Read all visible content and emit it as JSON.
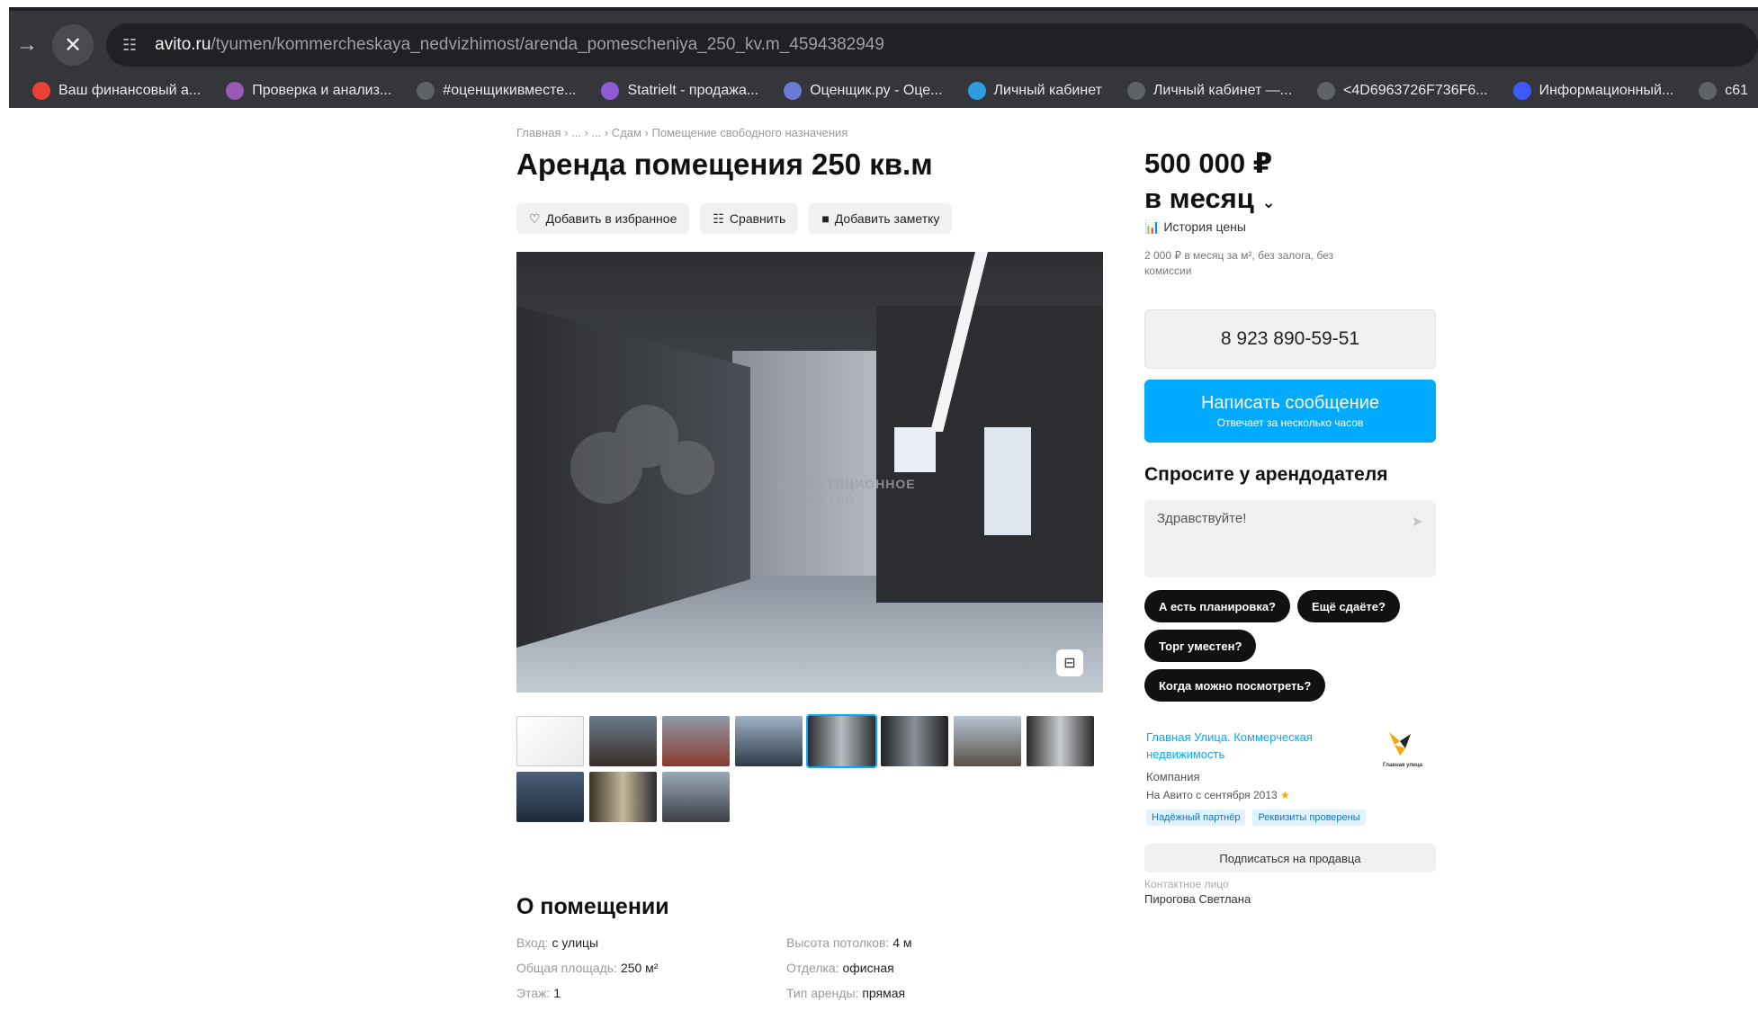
{
  "browser": {
    "url_domain": "avito.ru",
    "url_path": "/tyumen/kommercheskaya_nedvizhimost/arenda_pomescheniya_250_kv.m_4594382949",
    "bookmarks": [
      {
        "label": "Ваш финансовый а...",
        "icon": "bank-icon",
        "color": "#e94235"
      },
      {
        "label": "Проверка и анализ...",
        "icon": "check-icon",
        "color": "#9b59b6"
      },
      {
        "label": "#оценщикивместе...",
        "icon": "globe-icon",
        "color": "#5f6368"
      },
      {
        "label": "Statrielt - продажа...",
        "icon": "stat-icon",
        "color": "#8e5ad6"
      },
      {
        "label": "Оценщик.ру - Оце...",
        "icon": "star-icon",
        "color": "#6c7ad6"
      },
      {
        "label": "Личный кабинет",
        "icon": "cabinet-icon",
        "color": "#2f9be0"
      },
      {
        "label": "Личный кабинет —...",
        "icon": "globe-icon",
        "color": "#5f6368"
      },
      {
        "label": "<4D6963726F736F6...",
        "icon": "globe-icon",
        "color": "#5f6368"
      },
      {
        "label": "Информационный...",
        "icon": "info-icon",
        "color": "#3d5afe"
      },
      {
        "label": "c61",
        "icon": "globe-icon",
        "color": "#5f6368"
      }
    ]
  },
  "listing": {
    "breadcrumbs": "Главная › ... › ... › Сдам › Помещение свободного назначения",
    "title": "Аренда помещения 250 кв.м",
    "actions": {
      "favorite": "Добавить в избранное",
      "compare": "Сравнить",
      "note": "Добавить заметку"
    },
    "photo_watermark": "ИНВЕСТИЦИОННОЕ",
    "photo_watermark2": "АГЕНТСТВО",
    "about_title": "О помещении",
    "params": [
      {
        "key": "Вход: ",
        "value": "с улицы",
        "key2": "Высота потолков: ",
        "value2": "4 м"
      },
      {
        "key": "Общая площадь: ",
        "value": "250 м²",
        "key2": "Отделка: ",
        "value2": "офисная"
      },
      {
        "key": "Этаж: ",
        "value": "1",
        "key2": "Тип аренды: ",
        "value2": "прямая"
      }
    ]
  },
  "sidebar": {
    "price_line1": "500 000 ₽",
    "price_line2": "в месяц",
    "price_history": "История цены",
    "price_note": "2 000 ₽ в месяц за м², без залога, без комиссии",
    "phone": "8 923 890-59-51",
    "message_btn": "Написать сообщение",
    "message_sub": "Отвечает за несколько часов",
    "ask_title": "Спросите у арендодателя",
    "ask_placeholder": "Здравствуйте!",
    "chips": [
      "А есть планировка?",
      "Ещё сдаёте?",
      "Торг уместен?",
      "Когда можно посмотреть?"
    ],
    "seller_name": "Главная Улица. Коммерческая недвижимость",
    "seller_type": "Компания",
    "seller_since": "На Авито с сентября 2013",
    "badges": [
      "Надёжный партнёр",
      "Реквизиты проверены"
    ],
    "subscribe_btn": "Подписаться на продавца",
    "contact_label": "Контактное лицо",
    "contact_name": "Пирогова Светлана",
    "logo_text": "Главная улица"
  },
  "colors": {
    "accent": "#00aaff",
    "chrome_bg": "#35363a",
    "chip_bg": "#111111"
  }
}
